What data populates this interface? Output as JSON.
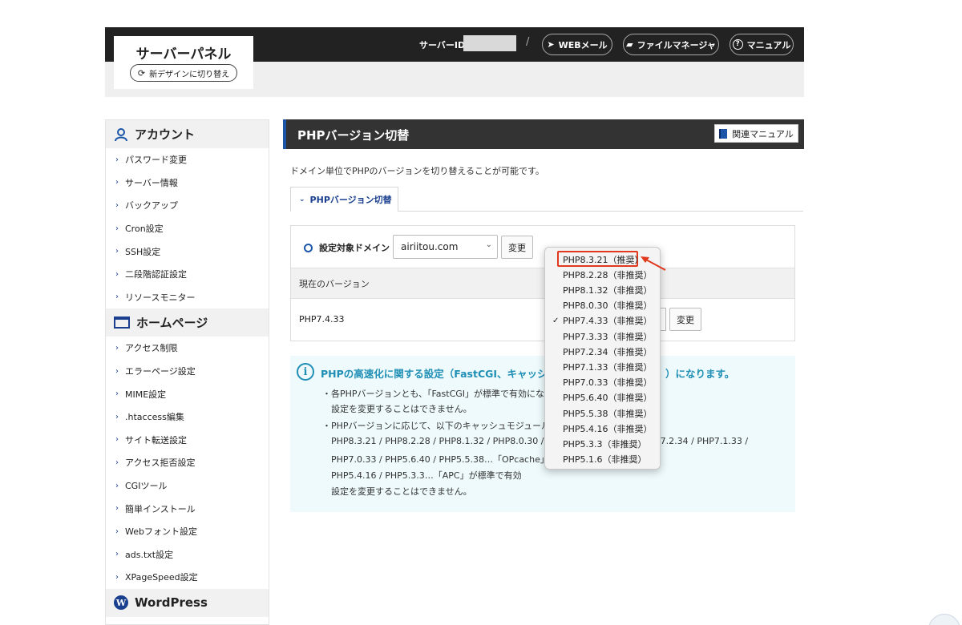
{
  "header": {
    "title": "サーバーパネル",
    "redesign_label": "新デザインに切り替え",
    "server_id_label": "サーバーID",
    "slash": "/",
    "webmail_label": "WEBメール",
    "file_manager_label": "ファイルマネージャ",
    "manual_label": "マニュアル"
  },
  "sidebar": {
    "sections": [
      {
        "title": "アカウント",
        "icon": "user-icon",
        "items": [
          "パスワード変更",
          "サーバー情報",
          "バックアップ",
          "Cron設定",
          "SSH設定",
          "二段階認証設定",
          "リソースモニター"
        ]
      },
      {
        "title": "ホームページ",
        "icon": "window-icon",
        "items": [
          "アクセス制限",
          "エラーページ設定",
          "MIME設定",
          ".htaccess編集",
          "サイト転送設定",
          "アクセス拒否設定",
          "CGIツール",
          "簡単インストール",
          "Webフォント設定",
          "ads.txt設定",
          "XPageSpeed設定"
        ]
      },
      {
        "title": "WordPress",
        "icon": "wordpress-icon",
        "items": []
      }
    ]
  },
  "main": {
    "title": "PHPバージョン切替",
    "manual_button": "関連マニュアル",
    "description": "ドメイン単位でPHPのバージョンを切り替えることが可能です。",
    "tab_label": "PHPバージョン切替",
    "target_domain_label": "設定対象ドメイン",
    "domain_value": "airiitou.com",
    "change_label": "変更",
    "current_version_header": "現在のバージョン",
    "current_version_value": "PHP7.4.33"
  },
  "info": {
    "title": "PHPの高速化に関する設定（FastCGI、キャッシュ",
    "title_tail": "）になります。",
    "lines": [
      "・各PHPバージョンとも、「FastCGI」が標準で有効にな",
      "設定を変更することはできません。",
      "・PHPバージョンに応じて、以下のキャッシュモジュール",
      "PHP8.3.21 / PHP8.2.28 / PHP8.1.32 / PHP8.0.30 / P",
      "PHP7.0.33 / PHP5.6.40 / PHP5.5.38…「OPcache」",
      "PHP5.4.16 / PHP5.3.3…「APC」が標準で有効",
      "設定を変更することはできません。"
    ],
    "line4_tail": "P7.2.34 / PHP7.1.33 /"
  },
  "dropdown": {
    "options": [
      {
        "label": "PHP8.3.21（推奨）",
        "checked": false
      },
      {
        "label": "PHP8.2.28（非推奨）",
        "checked": false
      },
      {
        "label": "PHP8.1.32（非推奨）",
        "checked": false
      },
      {
        "label": "PHP8.0.30（非推奨）",
        "checked": false
      },
      {
        "label": "PHP7.4.33（非推奨）",
        "checked": true
      },
      {
        "label": "PHP7.3.33（非推奨）",
        "checked": false
      },
      {
        "label": "PHP7.2.34（非推奨）",
        "checked": false
      },
      {
        "label": "PHP7.1.33（非推奨）",
        "checked": false
      },
      {
        "label": "PHP7.0.33（非推奨）",
        "checked": false
      },
      {
        "label": "PHP5.6.40（非推奨）",
        "checked": false
      },
      {
        "label": "PHP5.5.38（非推奨）",
        "checked": false
      },
      {
        "label": "PHP5.4.16（非推奨）",
        "checked": false
      },
      {
        "label": "PHP5.3.3（非推奨）",
        "checked": false
      },
      {
        "label": "PHP5.1.6（非推奨）",
        "checked": false
      }
    ],
    "check_glyph": "✓"
  },
  "colors": {
    "accent": "#1a55a8",
    "header_dark": "#222222",
    "info_bg": "#eefafc",
    "info_text": "#1f8fb5",
    "highlight": "#e0391e"
  }
}
